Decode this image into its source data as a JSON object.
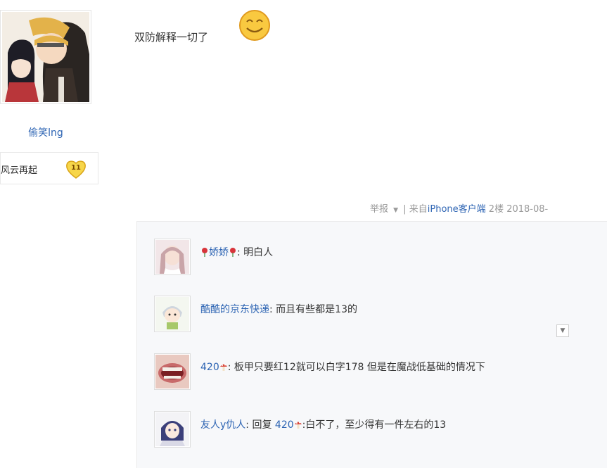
{
  "author": {
    "username": "偷笑lng",
    "rank_name": "风云再起",
    "rank_level": "11"
  },
  "post": {
    "content": "双防解释一切了"
  },
  "post_tail": {
    "report": "举报",
    "separator": "|",
    "source_prefix": "来自",
    "source_client": "iPhone客户端",
    "floor": "2楼",
    "date": "2018-08-"
  },
  "replies": [
    {
      "username": "娇娇",
      "colon": ": ",
      "text": "明白人"
    },
    {
      "username": "酷酷的京东快递",
      "colon": ": ",
      "text": "而且有些都是13的"
    },
    {
      "username": "420",
      "colon": ": ",
      "text": "板甲只要红12就可以白字178 但是在魔战低基础的情况下"
    },
    {
      "username": "友人y仇人",
      "colon": ": ",
      "reply_prefix": "回复 ",
      "reply_target": "420",
      "text": ":白不了，至少得有一件左右的13"
    }
  ],
  "icons": {
    "smiley": "smiley-emoticon-icon",
    "rose": "rose-icon",
    "mushroom": "mushroom-icon",
    "collapse": "collapse-arrow-icon",
    "dropdown": "dropdown-caret-icon",
    "rank_badge": "heart-level-badge-icon"
  },
  "colors": {
    "link": "#2d64b3",
    "panel_bg": "#f7f8fa",
    "meta_text": "#999999"
  }
}
